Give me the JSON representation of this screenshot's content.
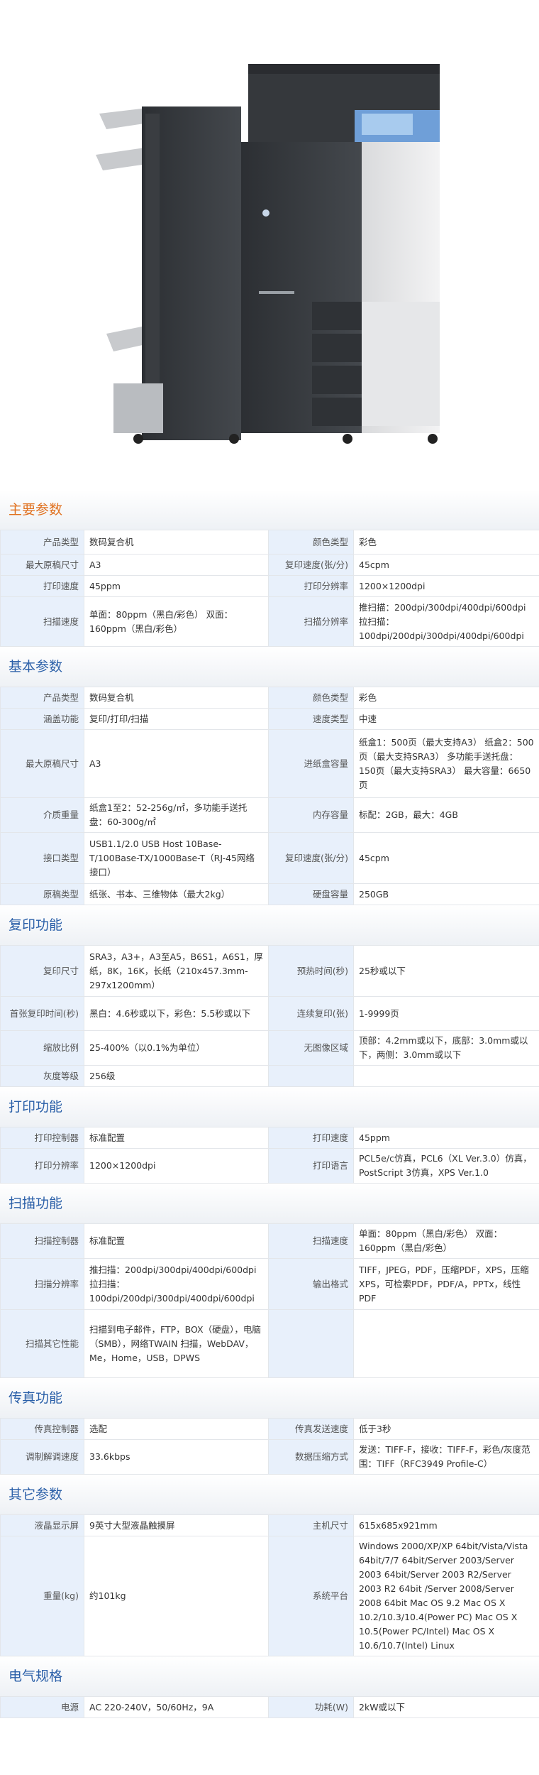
{
  "sections": [
    {
      "title": "主要参数",
      "accent": "#e0701e",
      "rows": [
        {
          "h": 34,
          "k1": "产品类型",
          "v1": "数码复合机",
          "k2": "颜色类型",
          "v2": "彩色"
        },
        {
          "h": 30,
          "k1": "最大原稿尺寸",
          "v1": "A3",
          "k2": "复印速度(张/分)",
          "v2": "45cpm"
        },
        {
          "h": 30,
          "k1": "打印速度",
          "v1": "45ppm",
          "k2": "打印分辨率",
          "v2": "1200×1200dpi"
        },
        {
          "h": 70,
          "k1": "扫描速度",
          "v1": "单面：80ppm（黑白/彩色） 双面：160ppm（黑白/彩色）",
          "k2": "扫描分辨率",
          "v2": "推扫描：200dpi/300dpi/400dpi/600dpi 拉扫描：100dpi/200dpi/300dpi/400dpi/600dpi"
        }
      ]
    },
    {
      "title": "基本参数",
      "accent": "#2a5fa8",
      "rows": [
        {
          "h": 30,
          "k1": "产品类型",
          "v1": "数码复合机",
          "k2": "颜色类型",
          "v2": "彩色"
        },
        {
          "h": 30,
          "k1": "涵盖功能",
          "v1": "复印/打印/扫描",
          "k2": "速度类型",
          "v2": "中速"
        },
        {
          "h": 96,
          "k1": "最大原稿尺寸",
          "v1": "A3",
          "k2": "进纸盒容量",
          "v2": "纸盒1：500页（最大支持A3） 纸盒2：500页（最大支持SRA3） 多功能手送托盘：150页（最大支持SRA3） 最大容量：6650页"
        },
        {
          "h": 48,
          "k1": "介质重量",
          "v1": "纸盒1至2：52-256g/㎡，多功能手送托盘：60-300g/㎡",
          "k2": "内存容量",
          "v2": "标配：2GB，最大：4GB"
        },
        {
          "h": 72,
          "k1": "接口类型",
          "v1": "USB1.1/2.0 USB Host 10Base-T/100Base-TX/1000Base-T（RJ-45网络接口）",
          "k2": "复印速度(张/分)",
          "v2": "45cpm"
        },
        {
          "h": 30,
          "k1": "原稿类型",
          "v1": "纸张、书本、三维物体（最大2kg）",
          "k2": "硬盘容量",
          "v2": "250GB"
        }
      ]
    },
    {
      "title": "复印功能",
      "accent": "#2a5fa8",
      "rows": [
        {
          "h": 72,
          "k1": "复印尺寸",
          "v1": "SRA3，A3+，A3至A5，B6S1，A6S1，厚纸，8K，16K，长纸（210x457.3mm-297x1200mm）",
          "k2": "预热时间(秒)",
          "v2": "25秒或以下"
        },
        {
          "h": 48,
          "k1": "首张复印时间(秒)",
          "v1": "黑白：4.6秒或以下，彩色：5.5秒或以下",
          "k2": "连续复印(张)",
          "v2": "1-9999页"
        },
        {
          "h": 48,
          "k1": "缩放比例",
          "v1": "25-400%（以0.1%为单位）",
          "k2": "无图像区域",
          "v2": "顶部：4.2mm或以下，底部：3.0mm或以下，两侧：3.0mm或以下"
        },
        {
          "h": 30,
          "k1": "灰度等级",
          "v1": "256级",
          "k2": "",
          "v2": ""
        }
      ]
    },
    {
      "title": "打印功能",
      "accent": "#2a5fa8",
      "rows": [
        {
          "h": 30,
          "k1": "打印控制器",
          "v1": "标准配置",
          "k2": "打印速度",
          "v2": "45ppm"
        },
        {
          "h": 48,
          "k1": "打印分辨率",
          "v1": "1200×1200dpi",
          "k2": "打印语言",
          "v2": "PCL5e/c仿真，PCL6（XL Ver.3.0）仿真，PostScript 3仿真，XPS Ver.1.0"
        }
      ]
    },
    {
      "title": "扫描功能",
      "accent": "#2a5fa8",
      "rows": [
        {
          "h": 48,
          "k1": "扫描控制器",
          "v1": "标准配置",
          "k2": "扫描速度",
          "v2": "单面：80ppm（黑白/彩色） 双面：160ppm（黑白/彩色）"
        },
        {
          "h": 72,
          "k1": "扫描分辨率",
          "v1": "推扫描：200dpi/300dpi/400dpi/600dpi 拉扫描：100dpi/200dpi/300dpi/400dpi/600dpi",
          "k2": "输出格式",
          "v2": "TIFF，JPEG，PDF，压缩PDF，XPS，压缩XPS，可检索PDF，PDF/A，PPTx，线性PDF"
        },
        {
          "h": 96,
          "k1": "扫描其它性能",
          "v1": "扫描到电子邮件，FTP，BOX（硬盘），电脑（SMB），网络TWAIN 扫描，WebDAV，Me，Home，USB，DPWS",
          "k2": "",
          "v2": ""
        }
      ]
    },
    {
      "title": "传真功能",
      "accent": "#2a5fa8",
      "rows": [
        {
          "h": 30,
          "k1": "传真控制器",
          "v1": "选配",
          "k2": "传真发送速度",
          "v2": "低于3秒"
        },
        {
          "h": 48,
          "k1": "调制解调速度",
          "v1": "33.6kbps",
          "k2": "数据压缩方式",
          "v2": "发送：TIFF-F，接收：TIFF-F，彩色/灰度范围：TIFF（RFC3949 Profile-C）"
        }
      ]
    },
    {
      "title": "其它参数",
      "accent": "#2a5fa8",
      "rows": [
        {
          "h": 30,
          "k1": "液晶显示屏",
          "v1": "9英寸大型液晶触摸屏",
          "k2": "主机尺寸",
          "v2": "615x685x921mm"
        },
        {
          "h": 164,
          "k1": "重量(kg)",
          "v1": "约101kg",
          "k2": "系统平台",
          "v2": "Windows 2000/XP/XP 64bit/Vista/Vista 64bit/7/7 64bit/Server 2003/Server 2003 64bit/Server 2003 R2/Server 2003 R2 64bit /Server 2008/Server 2008 64bit Mac OS 9.2 Mac OS X 10.2/10.3/10.4(Power PC) Mac OS X 10.5(Power PC/Intel) Mac OS X 10.6/10.7(Intel) Linux"
        }
      ]
    },
    {
      "title": "电气规格",
      "accent": "#2a5fa8",
      "rows": [
        {
          "h": 30,
          "k1": "电源",
          "v1": "AC 220-240V，50/60Hz，9A",
          "k2": "功耗(W)",
          "v2": "2kW或以下"
        }
      ]
    }
  ]
}
